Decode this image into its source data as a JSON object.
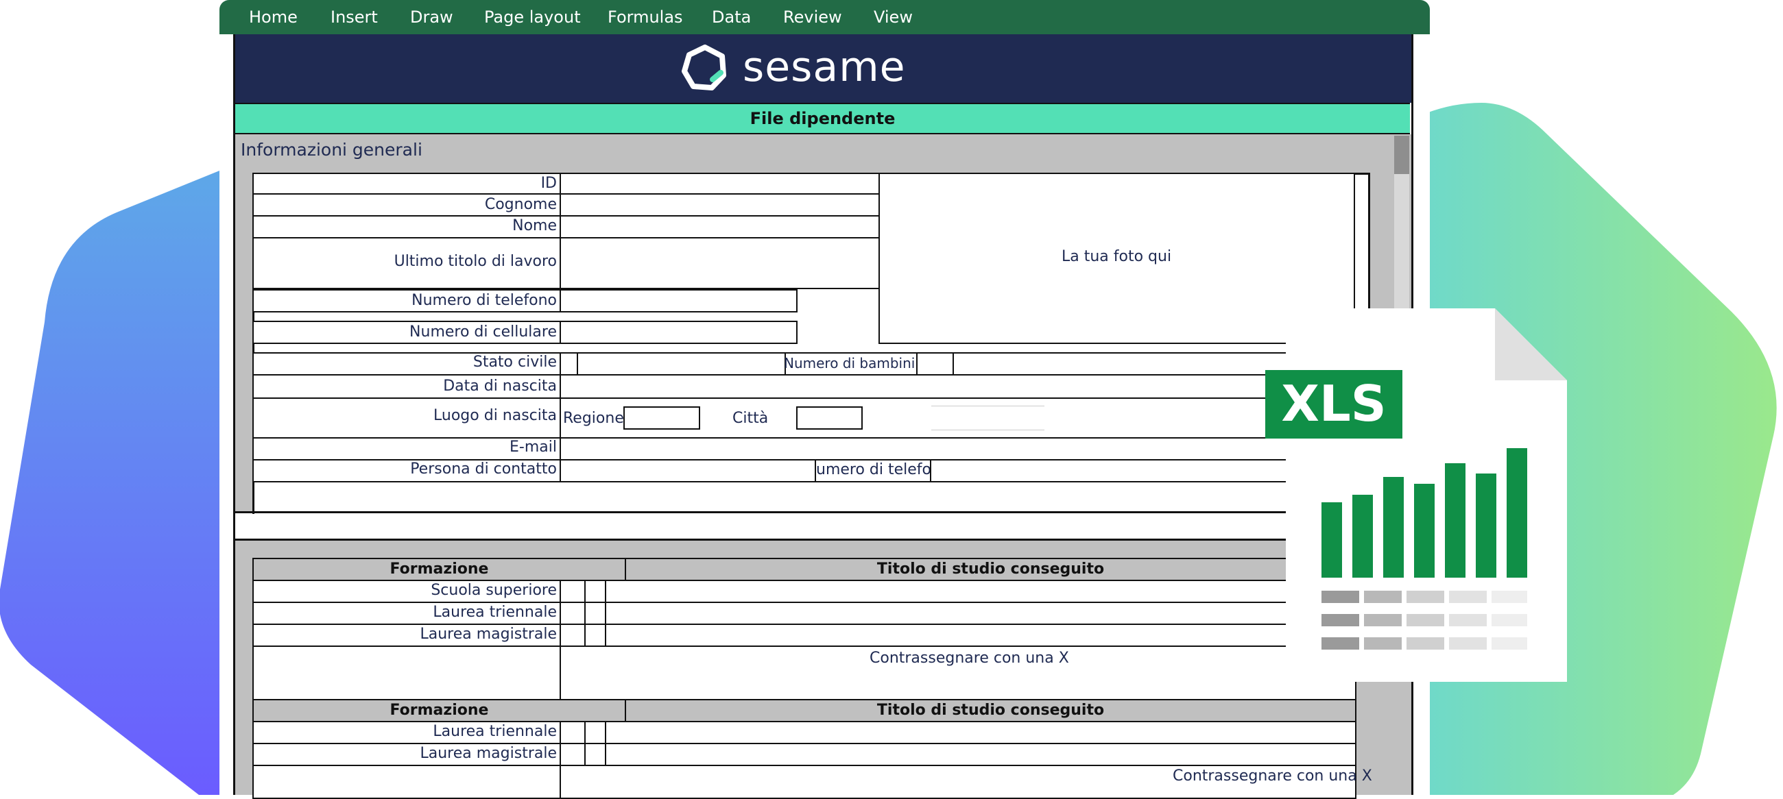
{
  "menu": {
    "items": [
      "Home",
      "Insert",
      "Draw",
      "Page layout",
      "Formulas",
      "Data",
      "Review",
      "View"
    ]
  },
  "brand": {
    "name": "sesame"
  },
  "sheet": {
    "title": "File dipendente",
    "section1": {
      "heading": "Informazioni generali",
      "fields": {
        "id": "ID",
        "cognome": "Cognome",
        "nome": "Nome",
        "ultimo_titolo": "Ultimo titolo di lavoro",
        "telefono": "Numero di telefono",
        "cellulare": "Numero di cellulare",
        "stato_civile": "Stato civile",
        "numero_bambini": "Numero di bambini",
        "data_nascita": "Data di nascita",
        "luogo_nascita": "Luogo di nascita",
        "regione": "Regione",
        "citta": "Città",
        "email": "E-mail",
        "persona_contatto": "Persona di contatto",
        "contatto_telefono": "umero di telefon"
      },
      "photo_placeholder": "La tua foto qui"
    },
    "section2": {
      "table1": {
        "header_left": "Formazione",
        "header_right": "Titolo di studio conseguito",
        "rows": [
          "Scuola superiore",
          "Laurea triennale",
          "Laurea magistrale"
        ],
        "note": "Contrassegnare con una X"
      },
      "table2": {
        "header_left": "Formazione",
        "header_right": "Titolo di studio conseguito",
        "rows": [
          "Laurea triennale",
          "Laurea magistrale"
        ],
        "note": "Contrassegnare con una X"
      }
    }
  },
  "badge": {
    "label": "XLS"
  },
  "colors": {
    "menubar": "#226b46",
    "banner": "#1f2a52",
    "title_bar": "#53e0b5",
    "xls_green": "#108f47"
  }
}
